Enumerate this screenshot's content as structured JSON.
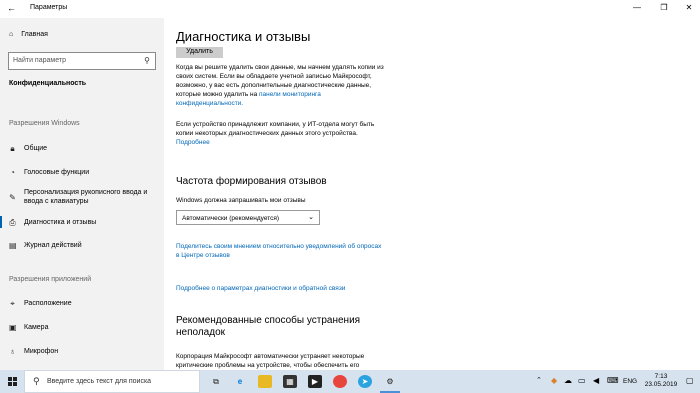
{
  "window": {
    "title": "Параметры",
    "back_icon": "back-arrow-icon",
    "controls": [
      "—",
      "❐",
      "✕"
    ]
  },
  "sidebar": {
    "home": "Главная",
    "search_placeholder": "Найти параметр",
    "section": "Конфиденциальность",
    "group_windows": "Разрешения Windows",
    "items_windows": [
      {
        "label": "Общие",
        "icon": "lock-icon"
      },
      {
        "label": "Голосовые функции",
        "icon": "voice-icon"
      },
      {
        "label1": "Персонализация рукописного ввода и",
        "label2": "ввода с клавиатуры",
        "icon": "pen-icon"
      },
      {
        "label": "Диагностика и отзывы",
        "icon": "diagnostics-icon",
        "active": true
      },
      {
        "label": "Журнал действий",
        "icon": "activity-icon"
      }
    ],
    "group_apps": "Разрешения приложений",
    "items_apps": [
      {
        "label": "Расположение",
        "icon": "location-icon"
      },
      {
        "label": "Камера",
        "icon": "camera-icon"
      },
      {
        "label": "Микрофон",
        "icon": "microphone-icon"
      }
    ]
  },
  "main": {
    "title": "Диагностика и отзывы",
    "delete_button": "Удалить",
    "para1": {
      "line1": "Когда вы решите удалить свои данные, мы начнем удалять копии из",
      "line2": "своих систем. Если вы обладаете учетной записью Майкрософт,",
      "line3": "возможно, у вас есть дополнительные диагностические данные,",
      "line4_pre": "которые можно удалить на ",
      "line4_link": "панели мониторинга",
      "line5_link": "конфиденциальности."
    },
    "para2": {
      "line1": "Если устройство принадлежит компании, у ИТ-отдела могут быть",
      "line2": "копии некоторых диагностических данных этого устройства.",
      "link": "Подробнее"
    },
    "feedback_heading": "Частота формирования отзывов",
    "feedback_label": "Windows должна запрашивать мои отзывы",
    "feedback_value": "Автоматически (рекомендуется)",
    "share_link_line1": "Поделитесь своим мнением относительно уведомлений об опросах",
    "share_link_line2": "в Центре отзывов",
    "more_link": "Подробнее о параметрах диагностики и обратной связи",
    "recommended_heading_line1": "Рекомендованные способы устранения",
    "recommended_heading_line2": "неполадок",
    "recommended_text_line1": "Корпорация Майкрософт автоматически устраняет некоторые",
    "recommended_text_line2": "критические проблемы на устройстве, чтобы обеспечить его"
  },
  "taskbar": {
    "search_placeholder": "Введите здесь текст для поиска",
    "lang": "ENG",
    "time": "7:13",
    "date": "23.05.2019"
  },
  "colors": {
    "accent": "#0063b1",
    "link": "#0067b8",
    "sidebar_bg": "#f2f2f2",
    "taskbar_bg": "#d6e3ee"
  }
}
